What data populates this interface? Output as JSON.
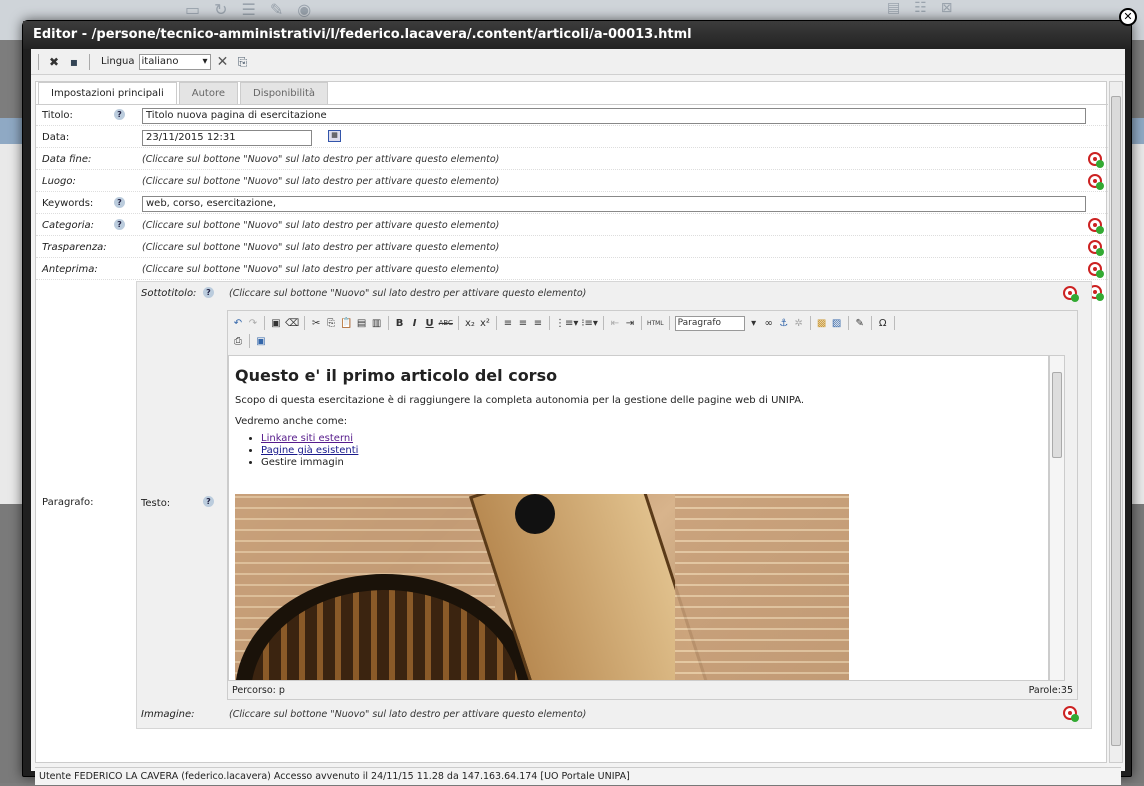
{
  "window": {
    "title": "Editor - /persone/tecnico-amministrativi/l/federico.lacavera/.content/articoli/a-00013.html"
  },
  "toolbar": {
    "lang_label": "Lingua",
    "lang_value": "italiano"
  },
  "tabs": [
    {
      "label": "Impostazioni principali",
      "active": true
    },
    {
      "label": "Autore",
      "active": false
    },
    {
      "label": "Disponibilità",
      "active": false
    }
  ],
  "form": {
    "titolo": {
      "label": "Titolo:",
      "value": "Titolo nuova pagina di esercitazione"
    },
    "data": {
      "label": "Data:",
      "value": "23/11/2015 12:31"
    },
    "data_fine": {
      "label": "Data fine:"
    },
    "luogo": {
      "label": "Luogo:"
    },
    "keywords": {
      "label": "Keywords:",
      "value": "web, corso, esercitazione,"
    },
    "categoria": {
      "label": "Categoria:"
    },
    "trasparenza": {
      "label": "Trasparenza:"
    },
    "anteprima": {
      "label": "Anteprima:"
    },
    "paragrafo": {
      "label": "Paragrafo:"
    },
    "sottotitolo": {
      "label": "Sottotitolo:"
    },
    "testo": {
      "label": "Testo:"
    },
    "immagine": {
      "label": "Immagine:"
    },
    "inactive_msg": "(Cliccare sul bottone \"Nuovo\" sul lato destro per attivare questo elemento)"
  },
  "editor": {
    "format_value": "Paragrafo",
    "heading": "Questo e' il primo articolo del corso",
    "intro": "Scopo di questa esercitazione è di raggiungere la completa autonomia per la gestione delle pagine web di UNIPA.",
    "lead": "Vedremo anche come:",
    "list": [
      "Linkare siti esterni",
      "Pagine già esistenti",
      "Gestire immagin"
    ],
    "path": "Percorso: p",
    "word_count": "Parole:35"
  },
  "status": {
    "text": "Utente FEDERICO LA CAVERA (federico.lacavera) Accesso avvenuto il 24/11/15 11.28 da 147.163.64.174 [UO Portale UNIPA]"
  },
  "colors": {
    "title_bar": "#222222",
    "new_button": "#cc2222",
    "link": "#551a8b"
  }
}
